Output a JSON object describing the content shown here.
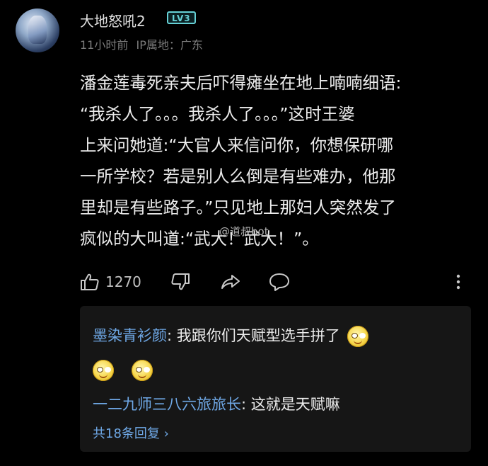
{
  "post": {
    "username": "大地怒吼2",
    "level": "LV3",
    "time": "11小时前",
    "ip_label": "IP属地：广东",
    "content_lines": [
      "潘金莲毒死亲夫后吓得瘫坐在地上喃喃细语:",
      "“我杀人了。。。我杀人了。。。”这时王婆",
      "上来问她道:“大官人来信问你，你想保研哪",
      "一所学校？若是别人么倒是有些难办，他那",
      "里却是有些路子。”只见地上那妇人突然发了",
      "疯似的大叫道:“武大！武大！”。"
    ],
    "like_count": "1270",
    "watermark": "@道叔bot"
  },
  "replies": {
    "items": [
      {
        "name": "墨染青衫颜",
        "text": "我跟你们天赋型选手拼了"
      },
      {
        "name": "一二九师三八六旅旅长",
        "text": "这就是天赋嘛"
      }
    ],
    "more_label": "共18条回复 ›"
  },
  "icons": {
    "like": "thumbs-up-icon",
    "dislike": "thumbs-down-icon",
    "share": "share-icon",
    "comment": "comment-icon",
    "more": "more-vertical-icon",
    "emoji": "smiling-face-emoji"
  },
  "colors": {
    "background": "#000000",
    "text": "#ececec",
    "meta": "#7c7c7c",
    "link": "#6fa8e6",
    "level_badge": "#66d1d6",
    "reply_bg": "#161616"
  }
}
